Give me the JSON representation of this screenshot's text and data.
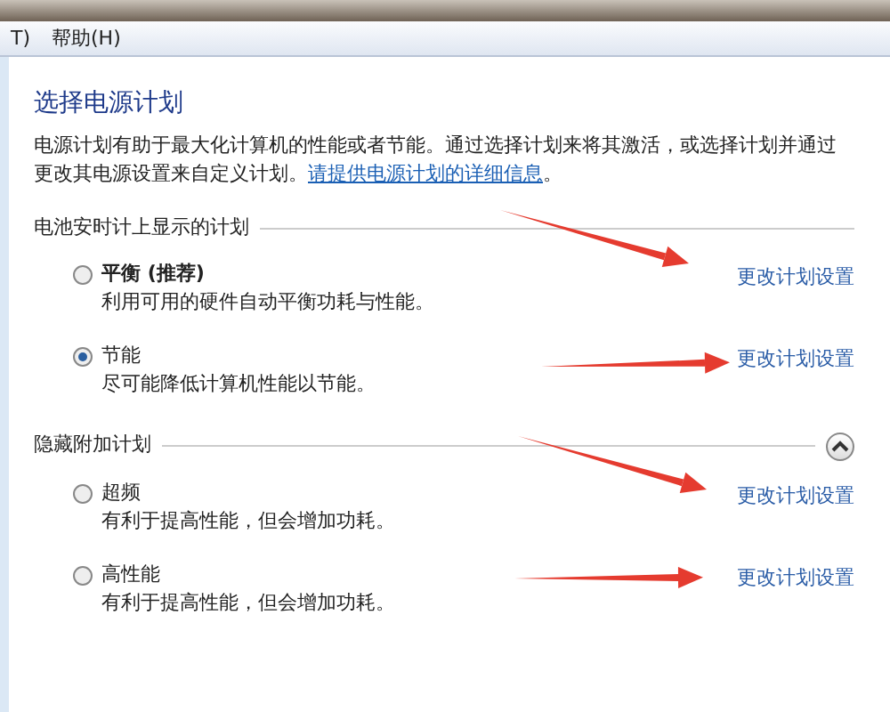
{
  "menu": [
    {
      "label": "T)"
    },
    {
      "label": "帮助(H)"
    }
  ],
  "heading": "选择电源计划",
  "description": {
    "text": "电源计划有助于最大化计算机的性能或者节能。通过选择计划来将其激活，或选择计划并通过更改其电源设置来自定义计划。",
    "link": "请提供电源计划的详细信息",
    "end": "。"
  },
  "sections": [
    {
      "title": "电池安时计上显示的计划",
      "plans": [
        {
          "name": "平衡 (推荐)",
          "emphasized": true,
          "selected": false,
          "description": "利用可用的硬件自动平衡功耗与性能。",
          "link": "更改计划设置",
          "annotated": true
        },
        {
          "name": "节能",
          "emphasized": false,
          "selected": true,
          "description": "尽可能降低计算机性能以节能。",
          "link": "更改计划设置",
          "annotated": true
        }
      ]
    },
    {
      "title": "隐藏附加计划",
      "expanded": true,
      "plans": [
        {
          "name": "超频",
          "emphasized": false,
          "selected": false,
          "description": "有利于提高性能，但会增加功耗。",
          "link": "更改计划设置",
          "annotated": true
        },
        {
          "name": "高性能",
          "emphasized": false,
          "selected": false,
          "description": "有利于提高性能，但会增加功耗。",
          "link": "更改计划设置",
          "annotated": true
        }
      ]
    }
  ]
}
